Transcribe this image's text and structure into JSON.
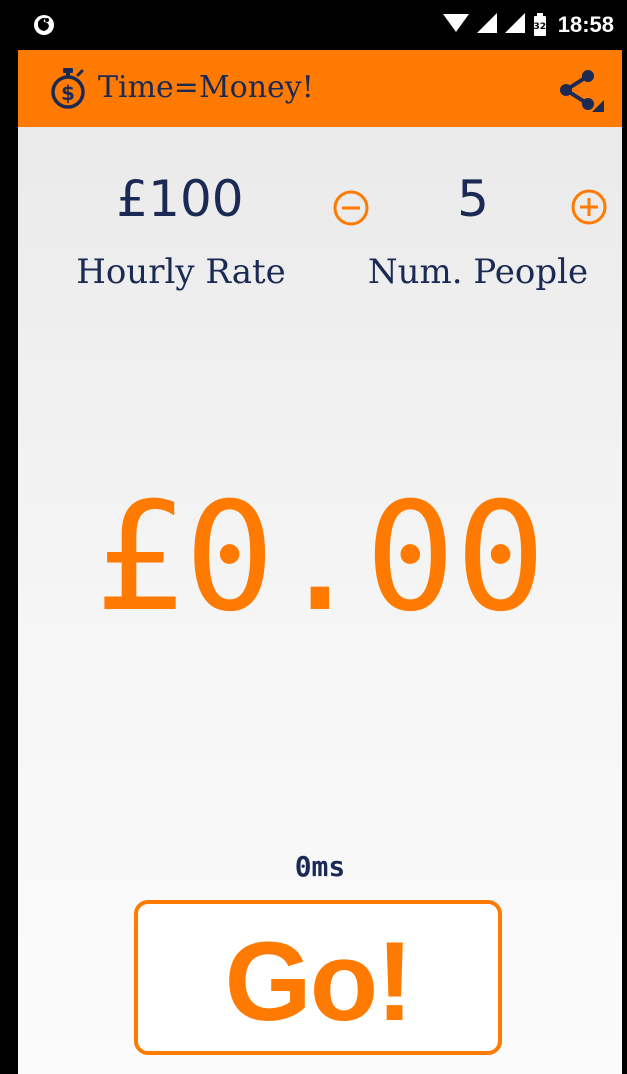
{
  "status_bar": {
    "time": "18:58",
    "battery_level": "32",
    "notification_icon": "firefox-icon"
  },
  "app_bar": {
    "title": "Time=Money!",
    "icon": "stopwatch-money-icon",
    "share_icon": "share-icon"
  },
  "controls": {
    "hourly_rate_value": "£100",
    "hourly_rate_label": "Hourly Rate",
    "people_value": "5",
    "people_label": "Num. People",
    "minus_icon": "minus-circle-icon",
    "plus_icon": "plus-circle-icon"
  },
  "amount": "£0.00",
  "elapsed": "0ms",
  "go_button": {
    "label": "Go!"
  },
  "colors": {
    "accent": "#ff7a00",
    "text_dark": "#1b2a55",
    "status_bar": "#000000"
  }
}
